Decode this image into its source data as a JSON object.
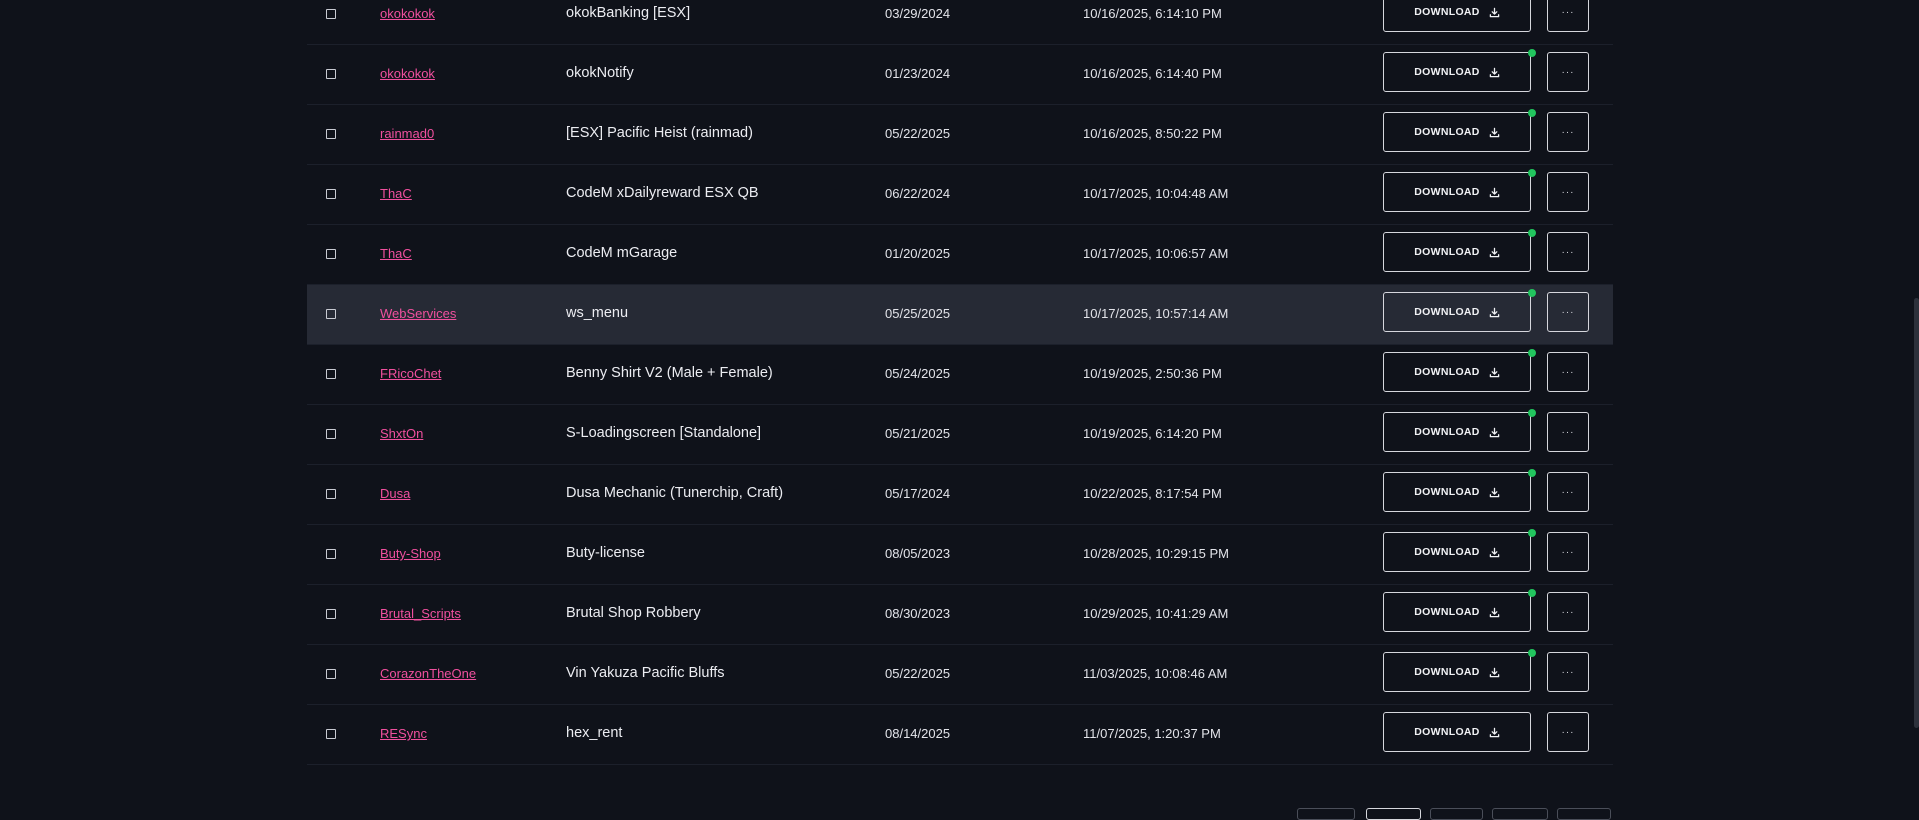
{
  "table": {
    "rows": [
      {
        "author": "okokokok",
        "name": "okokBanking [ESX]",
        "date1": "03/29/2024",
        "date2": "10/16/2025, 6:14:10 PM",
        "download_label": "DOWNLOAD",
        "more_label": "···",
        "has_dot": false,
        "highlight": false
      },
      {
        "author": "okokokok",
        "name": "okokNotify",
        "date1": "01/23/2024",
        "date2": "10/16/2025, 6:14:40 PM",
        "download_label": "DOWNLOAD",
        "more_label": "···",
        "has_dot": true,
        "highlight": false
      },
      {
        "author": "rainmad0",
        "name": "[ESX] Pacific Heist (rainmad)",
        "date1": "05/22/2025",
        "date2": "10/16/2025, 8:50:22 PM",
        "download_label": "DOWNLOAD",
        "more_label": "···",
        "has_dot": true,
        "highlight": false
      },
      {
        "author": "ThaC",
        "name": "CodeM xDailyreward ESX QB",
        "date1": "06/22/2024",
        "date2": "10/17/2025, 10:04:48 AM",
        "download_label": "DOWNLOAD",
        "more_label": "···",
        "has_dot": true,
        "highlight": false
      },
      {
        "author": "ThaC",
        "name": "CodeM mGarage",
        "date1": "01/20/2025",
        "date2": "10/17/2025, 10:06:57 AM",
        "download_label": "DOWNLOAD",
        "more_label": "···",
        "has_dot": true,
        "highlight": false
      },
      {
        "author": "WebServices",
        "name": "ws_menu",
        "date1": "05/25/2025",
        "date2": "10/17/2025, 10:57:14 AM",
        "download_label": "DOWNLOAD",
        "more_label": "···",
        "has_dot": true,
        "highlight": true
      },
      {
        "author": "FRicoChet",
        "name": "Benny Shirt V2 (Male + Female)",
        "date1": "05/24/2025",
        "date2": "10/19/2025, 2:50:36 PM",
        "download_label": "DOWNLOAD",
        "more_label": "···",
        "has_dot": true,
        "highlight": false
      },
      {
        "author": "ShxtOn",
        "name": "S-Loadingscreen [Standalone]",
        "date1": "05/21/2025",
        "date2": "10/19/2025, 6:14:20 PM",
        "download_label": "DOWNLOAD",
        "more_label": "···",
        "has_dot": true,
        "highlight": false
      },
      {
        "author": "Dusa",
        "name": "Dusa Mechanic (Tunerchip, Craft)",
        "date1": "05/17/2024",
        "date2": "10/22/2025, 8:17:54 PM",
        "download_label": "DOWNLOAD",
        "more_label": "···",
        "has_dot": true,
        "highlight": false
      },
      {
        "author": "Buty-Shop",
        "name": "Buty-license",
        "date1": "08/05/2023",
        "date2": "10/28/2025, 10:29:15 PM",
        "download_label": "DOWNLOAD",
        "more_label": "···",
        "has_dot": true,
        "highlight": false
      },
      {
        "author": "Brutal_Scripts",
        "name": "Brutal Shop Robbery",
        "date1": "08/30/2023",
        "date2": "10/29/2025, 10:41:29 AM",
        "download_label": "DOWNLOAD",
        "more_label": "···",
        "has_dot": true,
        "highlight": false
      },
      {
        "author": "CorazonTheOne",
        "name": "Vin Yakuza Pacific Bluffs",
        "date1": "05/22/2025",
        "date2": "11/03/2025, 10:08:46 AM",
        "download_label": "DOWNLOAD",
        "more_label": "···",
        "has_dot": true,
        "highlight": false
      },
      {
        "author": "RESync",
        "name": "hex_rent",
        "date1": "08/14/2025",
        "date2": "11/07/2025, 1:20:37 PM",
        "download_label": "DOWNLOAD",
        "more_label": "···",
        "has_dot": false,
        "highlight": false
      }
    ]
  },
  "colors": {
    "background": "#0f121a",
    "row_highlight": "#262a35",
    "author_link": "#f0509e",
    "status_dot": "#22c55e"
  },
  "icons": {
    "download": "download-icon",
    "checkbox": "checkbox-icon"
  }
}
